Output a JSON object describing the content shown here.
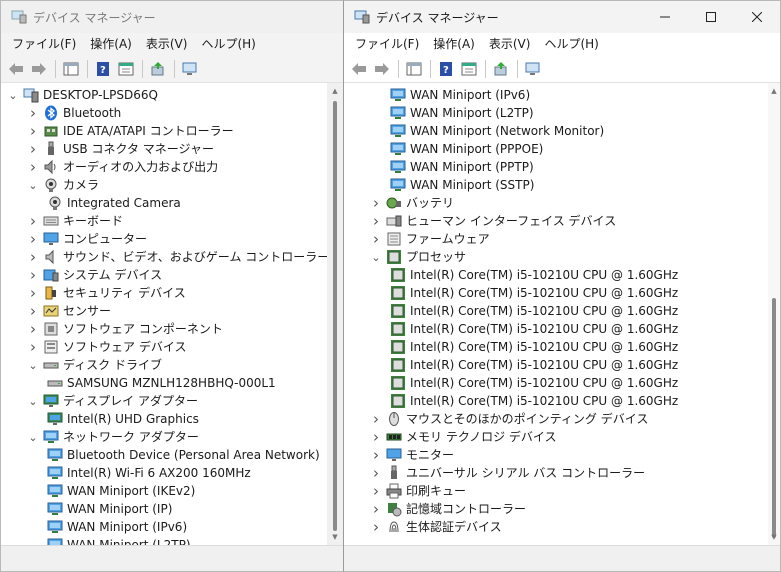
{
  "colors": {
    "accent": "#2f78d6",
    "window_bg": "#ffffff",
    "text": "#1a1a1a"
  },
  "left": {
    "title": "デバイス マネージャー",
    "menu": [
      "ファイル(F)",
      "操作(A)",
      "表示(V)",
      "ヘルプ(H)"
    ],
    "tree": [
      {
        "label": "DESKTOP-LPSD66Q",
        "level": 0,
        "toggle": "open",
        "icon": "computer-icon"
      },
      {
        "label": "Bluetooth",
        "level": 1,
        "toggle": "closed",
        "icon": "bluetooth-icon"
      },
      {
        "label": "IDE ATA/ATAPI コントローラー",
        "level": 1,
        "toggle": "closed",
        "icon": "ide-controller-icon"
      },
      {
        "label": "USB コネクタ マネージャー",
        "level": 1,
        "toggle": "closed",
        "icon": "usb-icon"
      },
      {
        "label": "オーディオの入力および出力",
        "level": 1,
        "toggle": "closed",
        "icon": "audio-icon"
      },
      {
        "label": "カメラ",
        "level": 1,
        "toggle": "open",
        "icon": "camera-icon"
      },
      {
        "label": "Integrated Camera",
        "level": 2,
        "toggle": "none",
        "icon": "camera-icon"
      },
      {
        "label": "キーボード",
        "level": 1,
        "toggle": "closed",
        "icon": "keyboard-icon"
      },
      {
        "label": "コンピューター",
        "level": 1,
        "toggle": "closed",
        "icon": "monitor-icon"
      },
      {
        "label": "サウンド、ビデオ、およびゲーム コントローラー",
        "level": 1,
        "toggle": "closed",
        "icon": "speaker-icon"
      },
      {
        "label": "システム デバイス",
        "level": 1,
        "toggle": "closed",
        "icon": "system-device-icon"
      },
      {
        "label": "セキュリティ デバイス",
        "level": 1,
        "toggle": "closed",
        "icon": "security-device-icon"
      },
      {
        "label": "センサー",
        "level": 1,
        "toggle": "closed",
        "icon": "sensor-icon"
      },
      {
        "label": "ソフトウェア コンポーネント",
        "level": 1,
        "toggle": "closed",
        "icon": "software-component-icon"
      },
      {
        "label": "ソフトウェア デバイス",
        "level": 1,
        "toggle": "closed",
        "icon": "software-device-icon"
      },
      {
        "label": "ディスク ドライブ",
        "level": 1,
        "toggle": "open",
        "icon": "disk-drive-icon"
      },
      {
        "label": "SAMSUNG MZNLH128HBHQ-000L1",
        "level": 2,
        "toggle": "none",
        "icon": "disk-drive-icon"
      },
      {
        "label": "ディスプレイ アダプター",
        "level": 1,
        "toggle": "open",
        "icon": "display-adapter-icon"
      },
      {
        "label": "Intel(R) UHD Graphics",
        "level": 2,
        "toggle": "none",
        "icon": "display-adapter-icon"
      },
      {
        "label": "ネットワーク アダプター",
        "level": 1,
        "toggle": "open",
        "icon": "network-adapter-icon"
      },
      {
        "label": "Bluetooth Device (Personal Area Network)",
        "level": 2,
        "toggle": "none",
        "icon": "network-adapter-icon"
      },
      {
        "label": "Intel(R) Wi-Fi 6 AX200 160MHz",
        "level": 2,
        "toggle": "none",
        "icon": "network-adapter-icon"
      },
      {
        "label": "WAN Miniport (IKEv2)",
        "level": 2,
        "toggle": "none",
        "icon": "network-adapter-icon"
      },
      {
        "label": "WAN Miniport (IP)",
        "level": 2,
        "toggle": "none",
        "icon": "network-adapter-icon"
      },
      {
        "label": "WAN Miniport (IPv6)",
        "level": 2,
        "toggle": "none",
        "icon": "network-adapter-icon"
      },
      {
        "label": "WAN Miniport (L2TP)",
        "level": 2,
        "toggle": "none",
        "icon": "network-adapter-icon"
      }
    ]
  },
  "right": {
    "title": "デバイス マネージャー",
    "menu": [
      "ファイル(F)",
      "操作(A)",
      "表示(V)",
      "ヘルプ(H)"
    ],
    "tree": [
      {
        "label": "WAN Miniport (IPv6)",
        "level": 2,
        "toggle": "none",
        "icon": "network-adapter-icon"
      },
      {
        "label": "WAN Miniport (L2TP)",
        "level": 2,
        "toggle": "none",
        "icon": "network-adapter-icon"
      },
      {
        "label": "WAN Miniport (Network Monitor)",
        "level": 2,
        "toggle": "none",
        "icon": "network-adapter-icon"
      },
      {
        "label": "WAN Miniport (PPPOE)",
        "level": 2,
        "toggle": "none",
        "icon": "network-adapter-icon"
      },
      {
        "label": "WAN Miniport (PPTP)",
        "level": 2,
        "toggle": "none",
        "icon": "network-adapter-icon"
      },
      {
        "label": "WAN Miniport (SSTP)",
        "level": 2,
        "toggle": "none",
        "icon": "network-adapter-icon"
      },
      {
        "label": "バッテリ",
        "level": 1,
        "toggle": "closed",
        "icon": "battery-icon"
      },
      {
        "label": "ヒューマン インターフェイス デバイス",
        "level": 1,
        "toggle": "closed",
        "icon": "hid-icon"
      },
      {
        "label": "ファームウェア",
        "level": 1,
        "toggle": "closed",
        "icon": "firmware-icon"
      },
      {
        "label": "プロセッサ",
        "level": 1,
        "toggle": "open",
        "icon": "processor-icon"
      },
      {
        "label": "Intel(R) Core(TM) i5-10210U CPU @ 1.60GHz",
        "level": 2,
        "toggle": "none",
        "icon": "processor-icon"
      },
      {
        "label": "Intel(R) Core(TM) i5-10210U CPU @ 1.60GHz",
        "level": 2,
        "toggle": "none",
        "icon": "processor-icon"
      },
      {
        "label": "Intel(R) Core(TM) i5-10210U CPU @ 1.60GHz",
        "level": 2,
        "toggle": "none",
        "icon": "processor-icon"
      },
      {
        "label": "Intel(R) Core(TM) i5-10210U CPU @ 1.60GHz",
        "level": 2,
        "toggle": "none",
        "icon": "processor-icon"
      },
      {
        "label": "Intel(R) Core(TM) i5-10210U CPU @ 1.60GHz",
        "level": 2,
        "toggle": "none",
        "icon": "processor-icon"
      },
      {
        "label": "Intel(R) Core(TM) i5-10210U CPU @ 1.60GHz",
        "level": 2,
        "toggle": "none",
        "icon": "processor-icon"
      },
      {
        "label": "Intel(R) Core(TM) i5-10210U CPU @ 1.60GHz",
        "level": 2,
        "toggle": "none",
        "icon": "processor-icon"
      },
      {
        "label": "Intel(R) Core(TM) i5-10210U CPU @ 1.60GHz",
        "level": 2,
        "toggle": "none",
        "icon": "processor-icon"
      },
      {
        "label": "マウスとそのほかのポインティング デバイス",
        "level": 1,
        "toggle": "closed",
        "icon": "mouse-icon"
      },
      {
        "label": "メモリ テクノロジ デバイス",
        "level": 1,
        "toggle": "closed",
        "icon": "memory-icon"
      },
      {
        "label": "モニター",
        "level": 1,
        "toggle": "closed",
        "icon": "monitor-icon"
      },
      {
        "label": "ユニバーサル シリアル バス コントローラー",
        "level": 1,
        "toggle": "closed",
        "icon": "usb-icon"
      },
      {
        "label": "印刷キュー",
        "level": 1,
        "toggle": "closed",
        "icon": "printer-icon"
      },
      {
        "label": "記憶域コントローラー",
        "level": 1,
        "toggle": "closed",
        "icon": "storage-controller-icon"
      },
      {
        "label": "生体認証デバイス",
        "level": 1,
        "toggle": "closed",
        "icon": "biometric-icon"
      }
    ]
  }
}
